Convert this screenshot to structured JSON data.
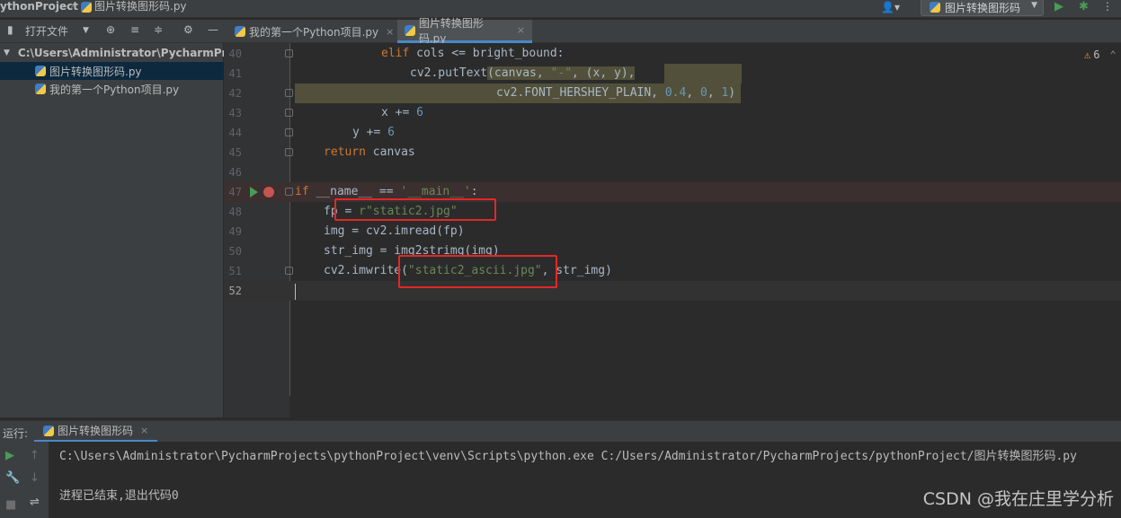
{
  "titlebar": {
    "project": "ythonProject",
    "separator": "›",
    "file": "图片转换图形码.py",
    "user_icon": "👤▾",
    "run_config": "图片转换图形码",
    "run_icon": "▶",
    "debug_icon": "🐞",
    "more_icon": "⋮"
  },
  "project_toolbar": {
    "open_file": "打开文件",
    "dropdown": "▼",
    "locate": "⊕",
    "expand": "≡",
    "collapse": "≑",
    "settings": "⚙",
    "hide": "—"
  },
  "project_tree": {
    "root": "C:\\Users\\Administrator\\PycharmPr",
    "files": [
      "图片转换图形码.py",
      "我的第一个Python项目.py"
    ]
  },
  "tabs": [
    {
      "label": "我的第一个Python项目.py",
      "close": "×"
    },
    {
      "label": "图片转换图形码.py",
      "close": "×"
    }
  ],
  "editor": {
    "warnings_count": "6",
    "line_numbers": [
      "40",
      "41",
      "42",
      "43",
      "44",
      "45",
      "47",
      "48",
      "49",
      "50",
      "51",
      "52"
    ],
    "lines": {
      "l40": {
        "kw": "elif ",
        "rest": "cols <= bright_bound:"
      },
      "l41": {
        "a": "cv2.putText",
        "b": "(canvas, ",
        "s": "\"-\"",
        "c": ", (x, y),"
      },
      "l42": {
        "a": "cv2.FONT_HERSHEY_PLAIN, ",
        "n1": "0.4",
        "b": ", ",
        "n2": "0",
        "c": ", ",
        "n3": "1",
        "d": ")"
      },
      "l43": {
        "a": "x += ",
        "n": "6"
      },
      "l44": {
        "a": "y += ",
        "n": "6"
      },
      "l45": {
        "kw": "return ",
        "rest": "canvas"
      },
      "l47": {
        "kw": "if ",
        "a": "__name__ == ",
        "s": "'__main__'",
        "b": ":"
      },
      "l48": {
        "a": "fp = ",
        "s": "r\"static2.jpg\""
      },
      "l49": {
        "a": "img = cv2.imread(fp)"
      },
      "l50": {
        "a": "str_img = img2strimg(img)"
      },
      "l51": {
        "a": "cv2.imwrite(",
        "s": "\"static2_ascii.jpg\"",
        "b": ", str_img)"
      }
    }
  },
  "run_panel": {
    "label": "运行:",
    "tab": "图片转换图形码",
    "close": "×",
    "command": "C:\\Users\\Administrator\\PycharmProjects\\pythonProject\\venv\\Scripts\\python.exe C:/Users/Administrator/PycharmProjects/pythonProject/图片转换图形码.py",
    "exit_message": "进程已结束,退出代码0"
  },
  "watermark": "CSDN @我在庄里学分析",
  "colors": {
    "accent": "#4a88c7",
    "keyword": "#cc7832",
    "string": "#6a8759",
    "number": "#6897bb",
    "annotation": "#e42727"
  }
}
